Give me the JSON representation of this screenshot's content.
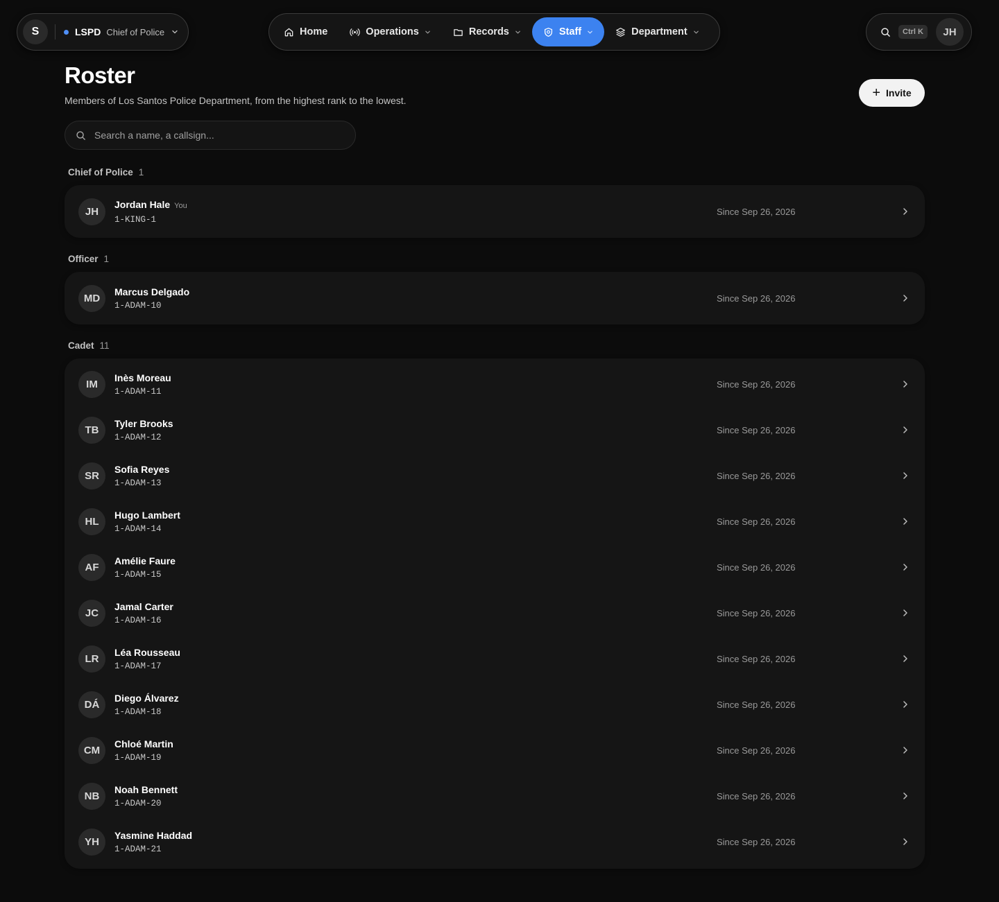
{
  "org": {
    "initial": "S",
    "name": "LSPD",
    "role": "Chief of Police",
    "status_color": "#4f8ff7"
  },
  "nav": {
    "items": [
      {
        "label": "Home",
        "icon": "home-icon",
        "has_dropdown": false,
        "active": false
      },
      {
        "label": "Operations",
        "icon": "radio-broadcast-icon",
        "has_dropdown": true,
        "active": false
      },
      {
        "label": "Records",
        "icon": "folder-icon",
        "has_dropdown": true,
        "active": false
      },
      {
        "label": "Staff",
        "icon": "shield-icon",
        "has_dropdown": true,
        "active": true
      },
      {
        "label": "Department",
        "icon": "layers-icon",
        "has_dropdown": true,
        "active": false
      }
    ],
    "active_color": "#3c82f0"
  },
  "utility": {
    "shortcut": "Ctrl K",
    "user_initials": "JH"
  },
  "page": {
    "title": "Roster",
    "subtitle": "Members of Los Santos Police Department, from the highest rank to the lowest.",
    "invite_label": "Invite",
    "search_placeholder": "Search a name, a callsign..."
  },
  "groups": [
    {
      "rank": "Chief of Police",
      "count": "1",
      "members": [
        {
          "initials": "JH",
          "name": "Jordan Hale",
          "you": "You",
          "callsign": "1-KING-1",
          "since": "Since Sep 26, 2026"
        }
      ]
    },
    {
      "rank": "Officer",
      "count": "1",
      "members": [
        {
          "initials": "MD",
          "name": "Marcus Delgado",
          "callsign": "1-ADAM-10",
          "since": "Since Sep 26, 2026"
        }
      ]
    },
    {
      "rank": "Cadet",
      "count": "11",
      "members": [
        {
          "initials": "IM",
          "name": "Inès Moreau",
          "callsign": "1-ADAM-11",
          "since": "Since Sep 26, 2026"
        },
        {
          "initials": "TB",
          "name": "Tyler Brooks",
          "callsign": "1-ADAM-12",
          "since": "Since Sep 26, 2026"
        },
        {
          "initials": "SR",
          "name": "Sofia Reyes",
          "callsign": "1-ADAM-13",
          "since": "Since Sep 26, 2026"
        },
        {
          "initials": "HL",
          "name": "Hugo Lambert",
          "callsign": "1-ADAM-14",
          "since": "Since Sep 26, 2026"
        },
        {
          "initials": "AF",
          "name": "Amélie Faure",
          "callsign": "1-ADAM-15",
          "since": "Since Sep 26, 2026"
        },
        {
          "initials": "JC",
          "name": "Jamal Carter",
          "callsign": "1-ADAM-16",
          "since": "Since Sep 26, 2026"
        },
        {
          "initials": "LR",
          "name": "Léa Rousseau",
          "callsign": "1-ADAM-17",
          "since": "Since Sep 26, 2026"
        },
        {
          "initials": "DÁ",
          "name": "Diego Álvarez",
          "callsign": "1-ADAM-18",
          "since": "Since Sep 26, 2026"
        },
        {
          "initials": "CM",
          "name": "Chloé Martin",
          "callsign": "1-ADAM-19",
          "since": "Since Sep 26, 2026"
        },
        {
          "initials": "NB",
          "name": "Noah Bennett",
          "callsign": "1-ADAM-20",
          "since": "Since Sep 26, 2026"
        },
        {
          "initials": "YH",
          "name": "Yasmine Haddad",
          "callsign": "1-ADAM-21",
          "since": "Since Sep 26, 2026"
        }
      ]
    }
  ]
}
